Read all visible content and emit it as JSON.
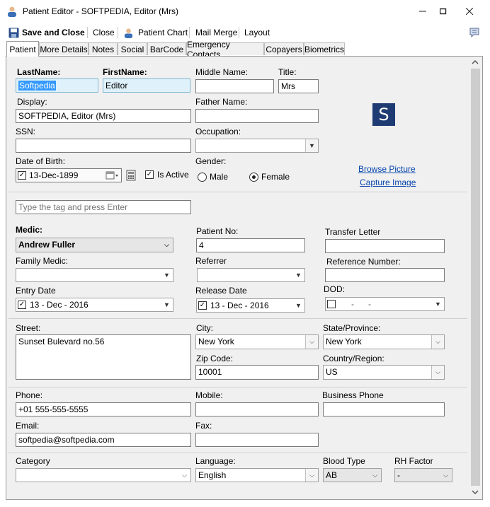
{
  "window": {
    "title": "Patient Editor - SOFTPEDIA, Editor (Mrs)"
  },
  "toolbar": {
    "save_close": "Save and Close",
    "close": "Close",
    "patient_chart": "Patient Chart",
    "mail_merge": "Mail Merge",
    "layout": "Layout"
  },
  "tabs": [
    "Patient",
    "More Details",
    "Notes",
    "Social",
    "BarCode",
    "Emergency Contacts",
    "Copayers",
    "Biometrics"
  ],
  "patient": {
    "last_name_label": "LastName:",
    "last_name": "Softpedia",
    "first_name_label": "FirstName:",
    "first_name": "Editor",
    "middle_name_label": "Middle Name:",
    "middle_name": "",
    "title_label": "Title:",
    "title": "Mrs",
    "display_label": "Display:",
    "display": "SOFTPEDIA, Editor (Mrs)",
    "father_name_label": "Father Name:",
    "father_name": "",
    "ssn_label": "SSN:",
    "ssn": "",
    "occupation_label": "Occupation:",
    "occupation": "",
    "dob_label": "Date of Birth:",
    "dob": "13-Dec-1899",
    "is_active_label": "Is Active",
    "gender_label": "Gender:",
    "male_label": "Male",
    "female_label": "Female",
    "gender_selected": "Female",
    "browse_picture": "Browse Picture",
    "capture_image": "Capture Image",
    "avatar_letter": "S"
  },
  "tags": {
    "placeholder": "Type the tag and press Enter"
  },
  "medical": {
    "medic_label": "Medic:",
    "medic": "Andrew Fuller",
    "patient_no_label": "Patient No:",
    "patient_no": "4",
    "transfer_letter_label": "Transfer Letter",
    "transfer_letter": "",
    "family_medic_label": "Family Medic:",
    "family_medic": "",
    "referrer_label": "Referrer",
    "referrer": "",
    "reference_number_label": "Reference Number:",
    "reference_number": "",
    "entry_date_label": "Entry Date",
    "entry_date": "13 - Dec - 2016",
    "release_date_label": "Release Date",
    "release_date": "13 - Dec - 2016",
    "dod_label": "DOD:",
    "dod": "-      -"
  },
  "address": {
    "street_label": "Street:",
    "street": "Sunset Bulevard no.56",
    "city_label": "City:",
    "city": "New York",
    "state_label": "State/Province:",
    "state": "New York",
    "zip_label": "Zip Code:",
    "zip": "10001",
    "country_label": "Country/Region:",
    "country": "US"
  },
  "contact": {
    "phone_label": "Phone:",
    "phone": "+01 555-555-5555",
    "mobile_label": "Mobile:",
    "mobile": "",
    "business_phone_label": "Business Phone",
    "business_phone": "",
    "email_label": "Email:",
    "email": "softpedia@softpedia.com",
    "fax_label": "Fax:",
    "fax": ""
  },
  "misc": {
    "category_label": "Category",
    "category": "",
    "language_label": "Language:",
    "language": "English",
    "blood_type_label": "Blood Type",
    "blood_type": "AB",
    "rh_factor_label": "RH Factor",
    "rh_factor": "-"
  },
  "colors": {
    "avatar_bg": "#1f3b73",
    "link": "#0645ad",
    "highlight_field": "#dff2fb"
  }
}
